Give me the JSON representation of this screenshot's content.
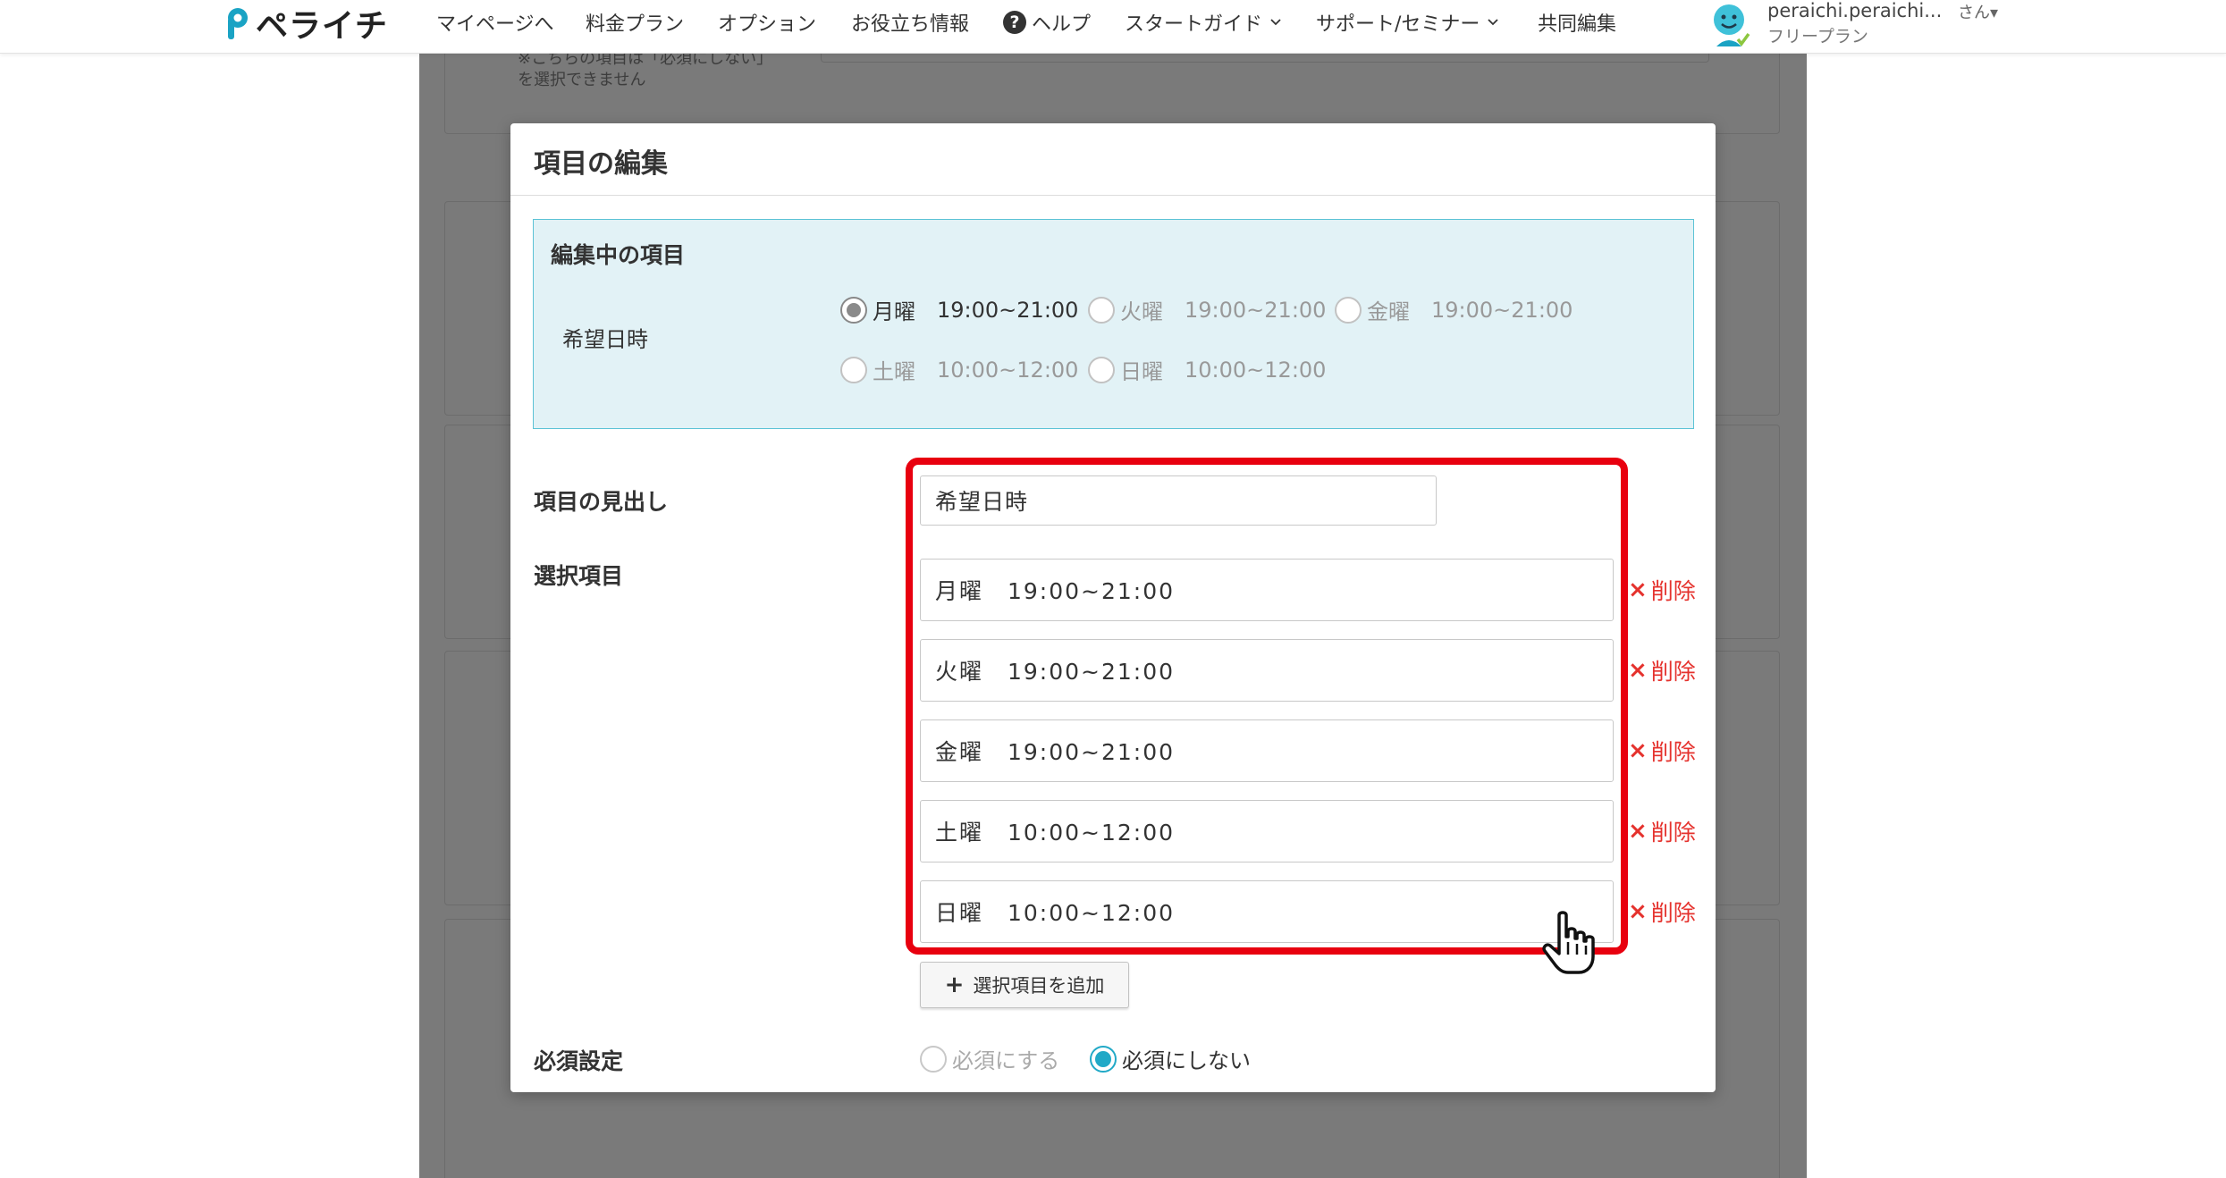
{
  "nav": {
    "logo_text": "ペライチ",
    "items": [
      "マイページへ",
      "料金プラン",
      "オプション",
      "お役立ち情報",
      "ヘルプ",
      "スタートガイド",
      "サポート/セミナー",
      "共同編集"
    ],
    "help_icon": "?",
    "user_name": "peraichi.peraichi...",
    "user_suffix": "さん",
    "user_plan": "フリープラン"
  },
  "background": {
    "note_line1": "※こちらの項目は「必須にしない」",
    "note_line2": "を選択できません"
  },
  "modal": {
    "title": "項目の編集",
    "editing": {
      "title": "編集中の項目",
      "label": "希望日時",
      "options": [
        {
          "day": "月曜",
          "time": "19:00~21:00",
          "selected": true
        },
        {
          "day": "火曜",
          "time": "19:00~21:00",
          "selected": false
        },
        {
          "day": "金曜",
          "time": "19:00~21:00",
          "selected": false
        },
        {
          "day": "土曜",
          "time": "10:00~12:00",
          "selected": false
        },
        {
          "day": "日曜",
          "time": "10:00~12:00",
          "selected": false
        }
      ]
    },
    "heading_label": "項目の見出し",
    "heading_value": "希望日時",
    "choices_label": "選択項目",
    "choices": [
      "月曜　19:00~21:00",
      "火曜　19:00~21:00",
      "金曜　19:00~21:00",
      "土曜　10:00~12:00",
      "日曜　10:00~12:00"
    ],
    "delete_label": "削除",
    "delete_icon": "×",
    "add_button": "選択項目を追加",
    "add_icon": "+",
    "required_label": "必須設定",
    "required_options": [
      {
        "label": "必須にする",
        "selected": false
      },
      {
        "label": "必須にしない",
        "selected": true
      }
    ]
  },
  "colors": {
    "accent": "#21a9c7",
    "highlight": "#e8000f",
    "delete": "#e5322d",
    "editing_bg": "#e2f2f6",
    "editing_border": "#5cc3d6",
    "dim_bg": "#7a7a7a"
  }
}
